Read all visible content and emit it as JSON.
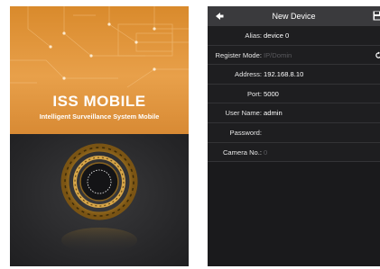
{
  "splash": {
    "title": "ISS MOBILE",
    "subtitle": "Intelligent Surveillance System Mobile",
    "colors": {
      "accent": "#e19637",
      "background": "#2b2b2e"
    },
    "logo_icon": "camera-lens-emblem"
  },
  "device_form": {
    "title": "New Device",
    "back_icon": "arrow-left",
    "save_icon": "save-floppy",
    "fields": [
      {
        "label": "Alias:",
        "value": "device 0",
        "placeholder": ""
      },
      {
        "label": "Register Mode:",
        "value": "",
        "placeholder": "IP/Domin"
      },
      {
        "label": "Address:",
        "value": "192.168.8.10",
        "placeholder": ""
      },
      {
        "label": "Port:",
        "value": "5000",
        "placeholder": ""
      },
      {
        "label": "User Name:",
        "value": "admin",
        "placeholder": ""
      },
      {
        "label": "Password:",
        "value": "",
        "placeholder": ""
      },
      {
        "label": "Camera No.:",
        "value": "",
        "placeholder": "0"
      }
    ],
    "colors": {
      "titlebar": "#3a3a3d",
      "background": "#1a1a1c",
      "text": "#ffffff",
      "placeholder": "#5a5a5e"
    }
  }
}
